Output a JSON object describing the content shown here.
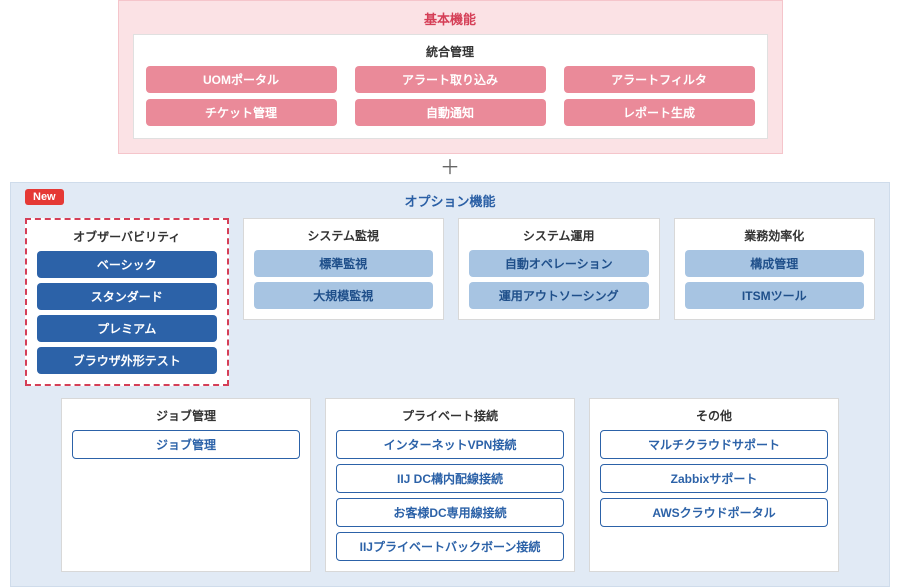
{
  "colors": {
    "pink_panel": "#fbe2e5",
    "pink_pill": "#ea8a99",
    "red_accent": "#d53f57",
    "blue_panel": "#e1eaf5",
    "blue_solid": "#2c62a8",
    "blue_light": "#a7c4e2",
    "badge_red": "#e53935"
  },
  "top": {
    "title": "基本機能",
    "inner_title": "統合管理",
    "row1": [
      "UOMポータル",
      "アラート取り込み",
      "アラートフィルタ"
    ],
    "row2": [
      "チケット管理",
      "自動通知",
      "レポート生成"
    ]
  },
  "plus": "＋",
  "bottom": {
    "badge": "New",
    "title": "オプション機能",
    "cards_top": [
      {
        "title": "オブザーバビリティ",
        "highlight": true,
        "style": "solid",
        "items": [
          "ベーシック",
          "スタンダード",
          "プレミアム",
          "ブラウザ外形テスト"
        ]
      },
      {
        "title": "システム監視",
        "style": "light",
        "items": [
          "標準監視",
          "大規模監視"
        ]
      },
      {
        "title": "システム運用",
        "style": "light",
        "items": [
          "自動オペレーション",
          "運用アウトソーシング"
        ]
      },
      {
        "title": "業務効率化",
        "style": "light",
        "items": [
          "構成管理",
          "ITSMツール"
        ]
      }
    ],
    "cards_bottom": [
      {
        "title": "ジョブ管理",
        "style": "outline",
        "items": [
          "ジョブ管理"
        ]
      },
      {
        "title": "プライベート接続",
        "style": "outline",
        "items": [
          "インターネットVPN接続",
          "IIJ DC構内配線接続",
          "お客様DC専用線接続",
          "IIJプライベートバックボーン接続"
        ]
      },
      {
        "title": "その他",
        "style": "outline",
        "items": [
          "マルチクラウドサポート",
          "Zabbixサポート",
          "AWSクラウドポータル"
        ]
      }
    ]
  }
}
